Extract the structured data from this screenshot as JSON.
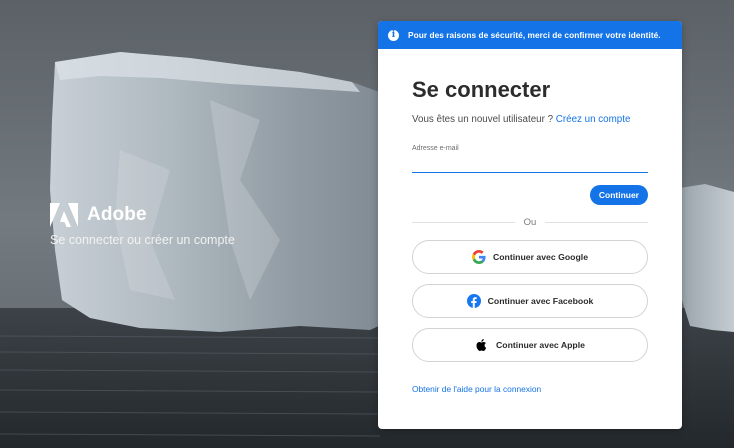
{
  "brand": {
    "name": "Adobe",
    "tagline": "Se connecter ou créer un compte",
    "logo_icon": "adobe-logo-icon"
  },
  "banner": {
    "text": "Pour des raisons de sécurité, merci de confirmer votre identité.",
    "icon": "info-icon",
    "color": "#1473e6"
  },
  "signin": {
    "title": "Se connecter",
    "new_user_text": "Vous êtes un nouvel utilisateur ?",
    "create_account_link": "Créez un compte",
    "email_label": "Adresse e-mail",
    "email_value": "",
    "continue_label": "Continuer",
    "or_label": "Ou",
    "social": [
      {
        "label": "Continuer avec Google",
        "icon": "google-icon"
      },
      {
        "label": "Continuer avec Facebook",
        "icon": "facebook-icon"
      },
      {
        "label": "Continuer avec Apple",
        "icon": "apple-icon"
      }
    ],
    "help_link": "Obtenir de l'aide pour la connexion"
  },
  "colors": {
    "accent": "#1473e6",
    "text": "#2c2c2c"
  }
}
